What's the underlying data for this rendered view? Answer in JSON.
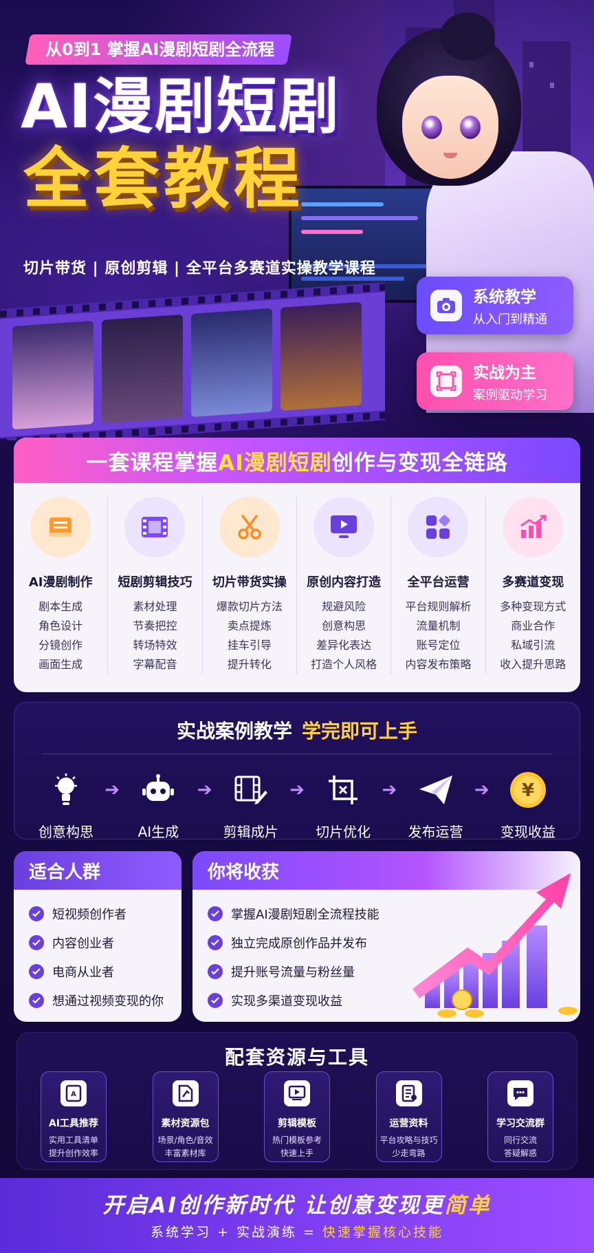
{
  "hero": {
    "tagline": "从0到1 掌握AI漫剧短剧全流程",
    "title_line1": "AI漫剧短剧",
    "title_line2": "全套教程",
    "subtag": "切片带货 | 原创剪辑 | 全平台多赛道实操教学课程",
    "badges": [
      {
        "title": "系统教学",
        "sub": "从入门到精通",
        "icon": "camera-icon",
        "color": "#6b4cff"
      },
      {
        "title": "实战为主",
        "sub": "案例驱动学习",
        "icon": "frame-icon",
        "color": "#ff4fae"
      }
    ]
  },
  "overview": {
    "title_pre": "一套课程掌握",
    "title_hl": "AI漫剧短剧",
    "title_post": "创作与变现全链路",
    "columns": [
      {
        "title": "AI漫剧制作",
        "icon": "book-icon",
        "items": [
          "剧本生成",
          "角色设计",
          "分镜创作",
          "画面生成"
        ]
      },
      {
        "title": "短剧剪辑技巧",
        "icon": "film-icon",
        "items": [
          "素材处理",
          "节奏把控",
          "转场特效",
          "字幕配音"
        ]
      },
      {
        "title": "切片带货实操",
        "icon": "scissors-icon",
        "items": [
          "爆款切片方法",
          "卖点提炼",
          "挂车引导",
          "提升转化"
        ]
      },
      {
        "title": "原创内容打造",
        "icon": "play-screen-icon",
        "items": [
          "规避风险",
          "创意构思",
          "差异化表达",
          "打造个人风格"
        ]
      },
      {
        "title": "全平台运营",
        "icon": "apps-icon",
        "items": [
          "平台规则解析",
          "流量机制",
          "账号定位",
          "内容发布策略"
        ]
      },
      {
        "title": "多赛道变现",
        "icon": "growth-chart-icon",
        "items": [
          "多种变现方式",
          "商业合作",
          "私域引流",
          "收入提升思路"
        ]
      }
    ]
  },
  "practice": {
    "title": "实战案例教学",
    "title_hl": "学完即可上手",
    "steps": [
      {
        "label": "创意构思",
        "icon": "lightbulb-icon"
      },
      {
        "label": "AI生成",
        "icon": "robot-icon"
      },
      {
        "label": "剪辑成片",
        "icon": "film-edit-icon"
      },
      {
        "label": "切片优化",
        "icon": "crop-icon"
      },
      {
        "label": "发布运营",
        "icon": "paper-plane-icon"
      },
      {
        "label": "变现收益",
        "icon": "yen-coin-icon"
      }
    ]
  },
  "audience": {
    "title": "适合人群",
    "items": [
      "短视频创作者",
      "内容创业者",
      "电商从业者",
      "想通过视频变现的你"
    ]
  },
  "gains": {
    "title": "你将收获",
    "items": [
      "掌握AI漫剧短剧全流程技能",
      "独立完成原创作品并发布",
      "提升账号流量与粉丝量",
      "实现多渠道变现收益"
    ]
  },
  "resources": {
    "title": "配套资源与工具",
    "tools": [
      {
        "name": "AI工具推荐",
        "desc1": "实用工具清单",
        "desc2": "提升创作效率",
        "icon": "ai-tool-icon"
      },
      {
        "name": "素材资源包",
        "desc1": "场景/角色/音效",
        "desc2": "丰富素材库",
        "icon": "material-pack-icon"
      },
      {
        "name": "剪辑模板",
        "desc1": "热门模板参考",
        "desc2": "快速上手",
        "icon": "template-icon"
      },
      {
        "name": "运营资料",
        "desc1": "平台攻略与技巧",
        "desc2": "少走弯路",
        "icon": "document-icon"
      },
      {
        "name": "学习交流群",
        "desc1": "同行交流",
        "desc2": "答疑解惑",
        "icon": "chat-icon"
      }
    ]
  },
  "footer": {
    "line1_pre": "开启AI创作新时代  让创意变现更",
    "line1_hl": "简单",
    "line2_pre": "系统学习 + 实战演练 = ",
    "line2_hl": "快速掌握核心技能"
  },
  "colors": {
    "accent_yellow": "#ffd23a",
    "accent_pink": "#ff5fc4",
    "accent_purple": "#7c49ff"
  }
}
